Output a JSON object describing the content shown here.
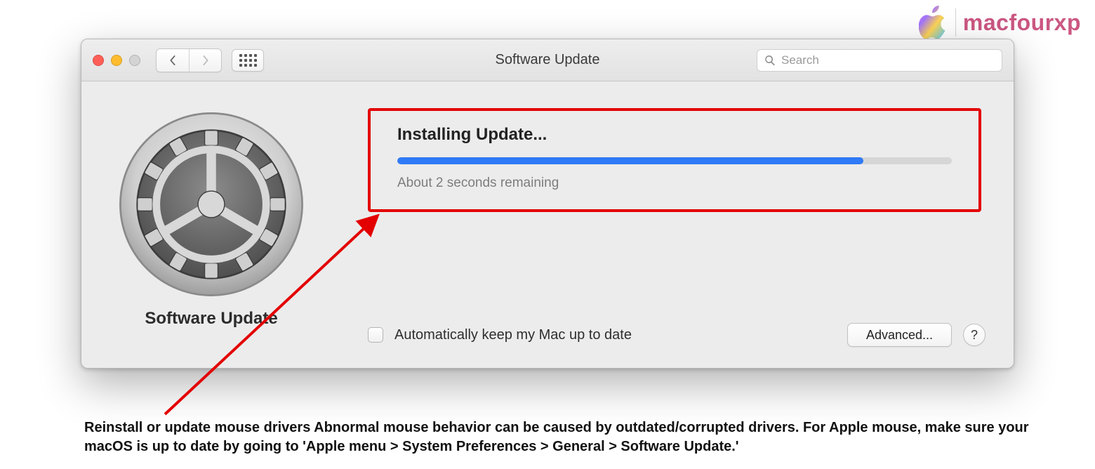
{
  "watermark": {
    "brand": "macfourxp"
  },
  "window": {
    "title": "Software Update",
    "search_placeholder": "Search"
  },
  "sidebar": {
    "label": "Software Update"
  },
  "update": {
    "heading": "Installing Update...",
    "progress_percent": 84,
    "remaining_text": "About 2 seconds remaining"
  },
  "auto_update": {
    "label": "Automatically keep my Mac up to date",
    "checked": false
  },
  "buttons": {
    "advanced": "Advanced...",
    "help": "?"
  },
  "caption": "Reinstall or update mouse drivers Abnormal mouse behavior can be caused by outdated/corrupted drivers. For Apple mouse, make sure your macOS is up to date by going to 'Apple menu > System Preferences > General > Software Update.'"
}
